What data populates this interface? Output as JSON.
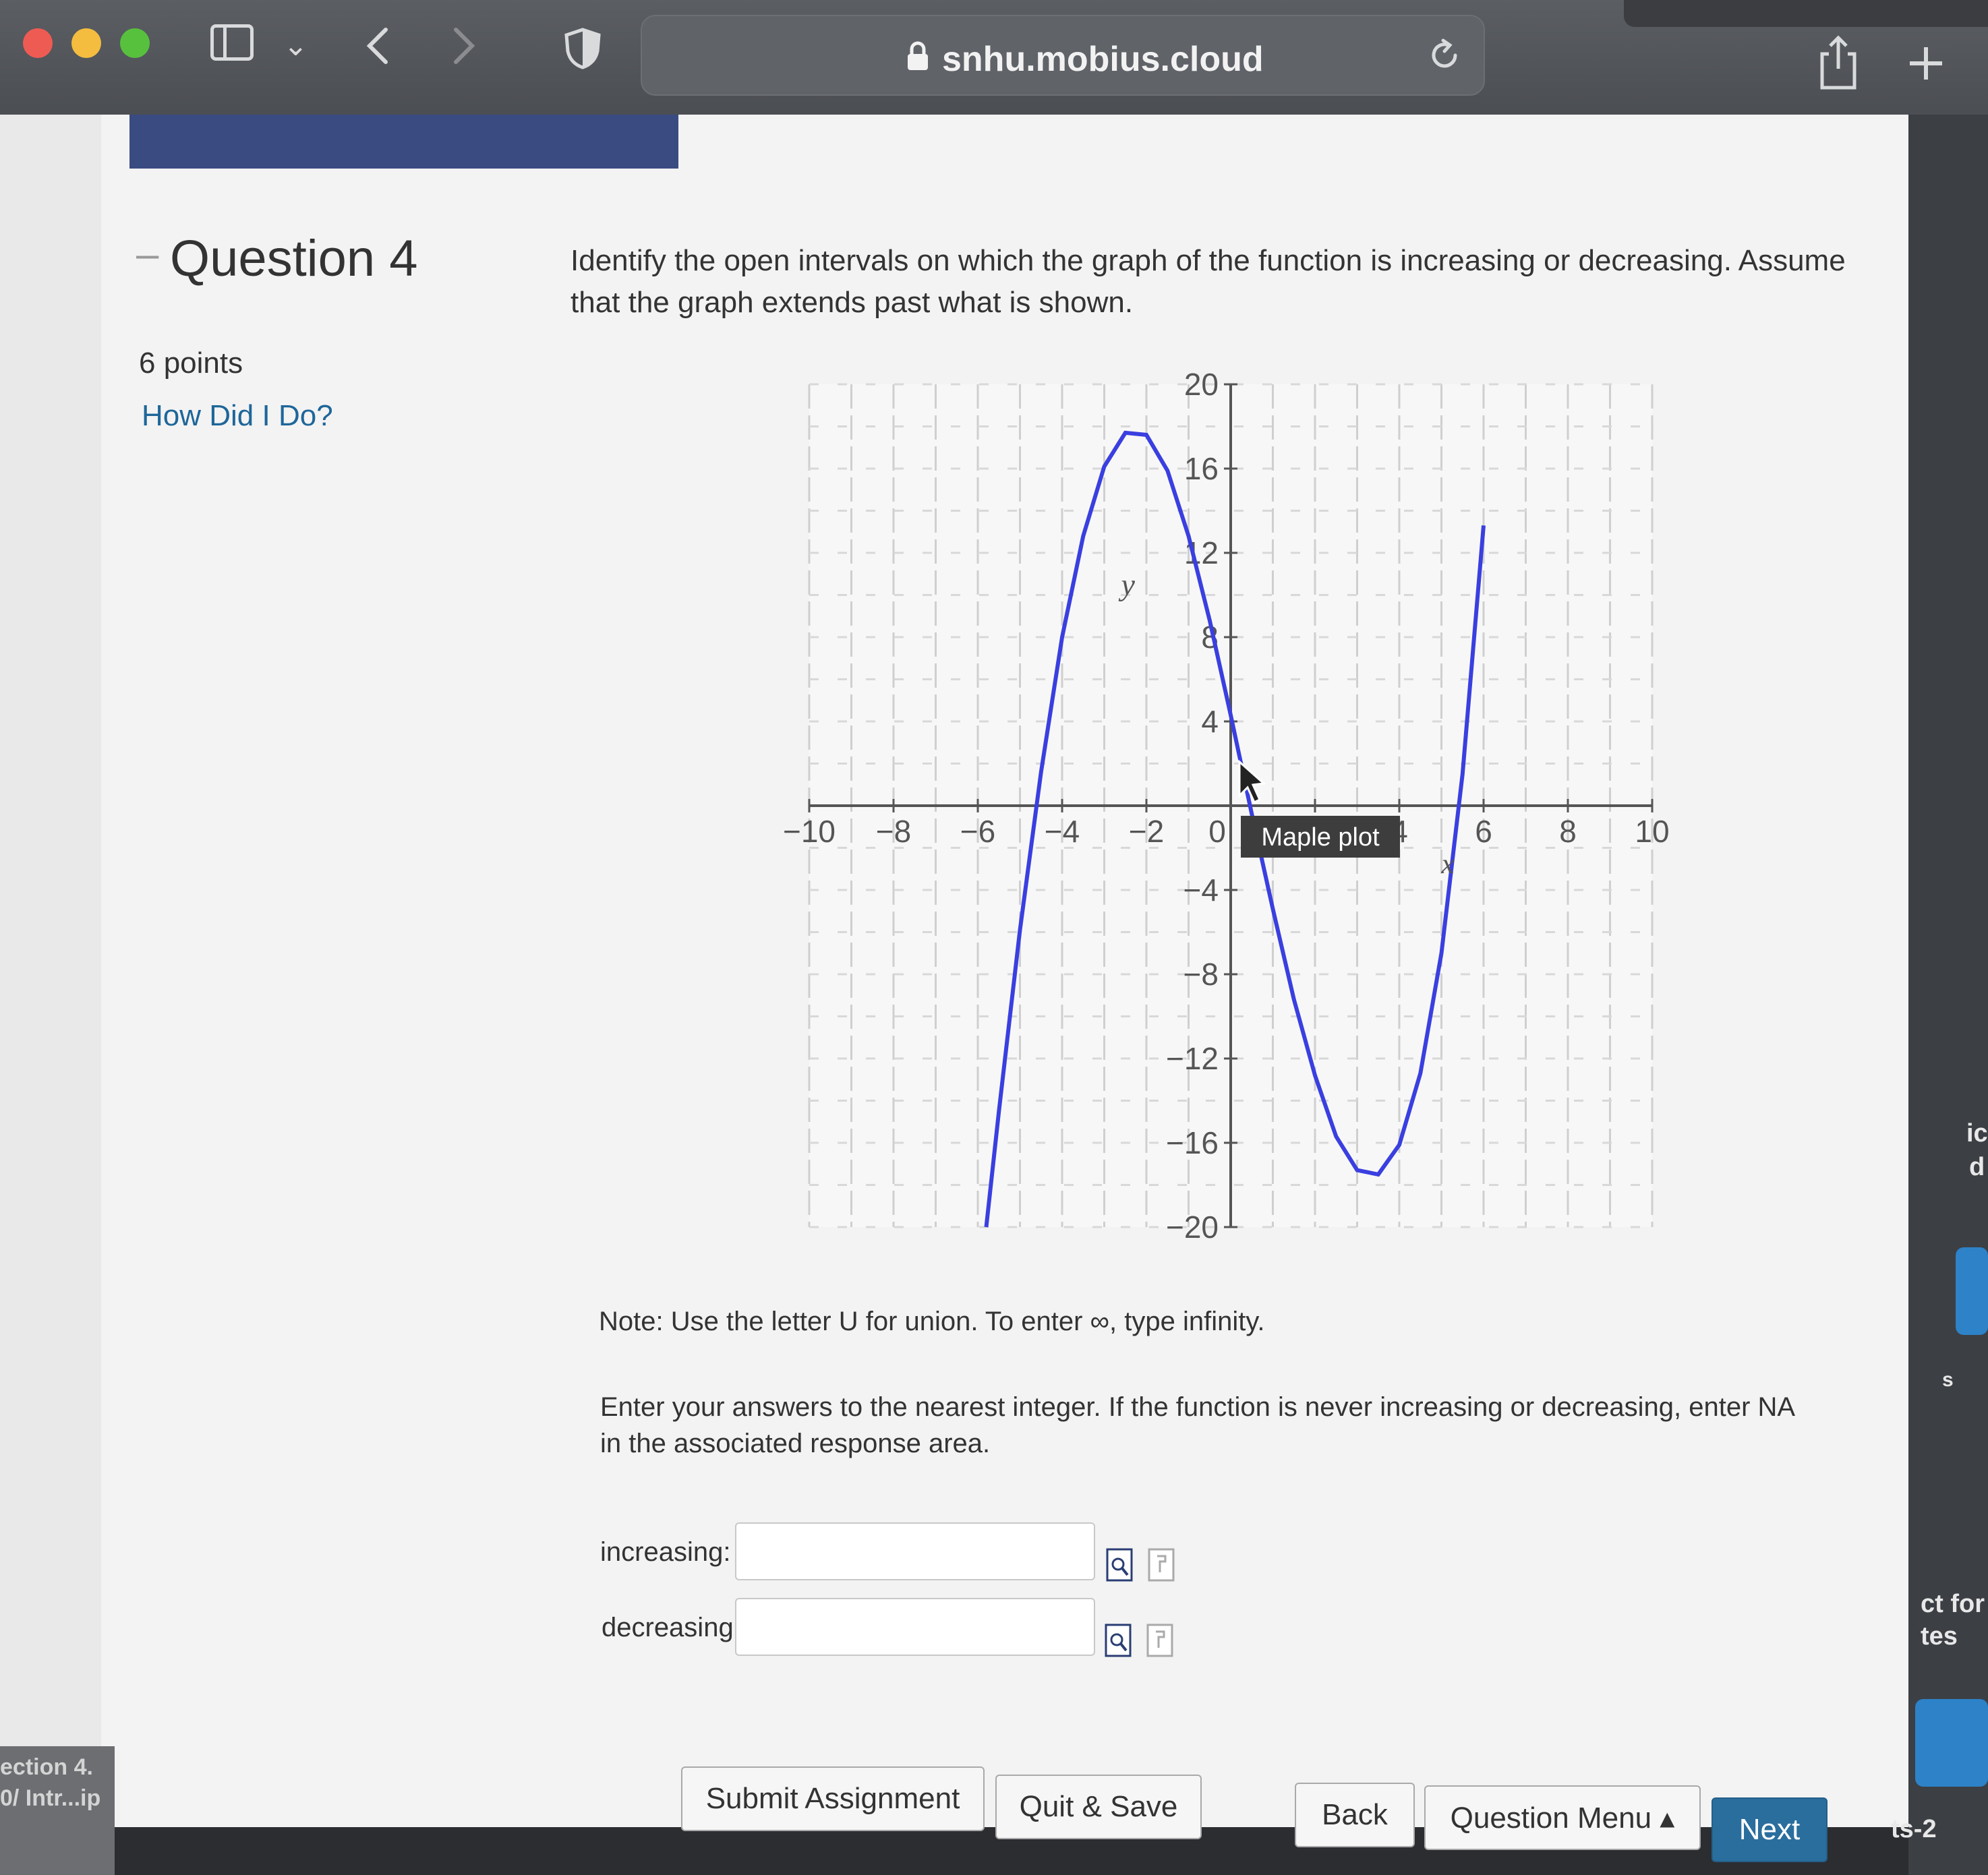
{
  "browser": {
    "url": "snhu.mobius.cloud"
  },
  "question": {
    "title": "Question 4",
    "points": "6 points",
    "how_link": "How Did I Do?",
    "prompt": "Identify the open intervals on which the graph of the function is increasing or decreasing. Assume that the graph extends past what is shown.",
    "note": "Note: Use the letter U for union. To enter ∞, type infinity.",
    "instructions": "Enter your answers to the nearest integer. If the function is never increasing or decreasing, enter NA in the associated response area.",
    "increasing_label": "increasing:",
    "increasing_value": "",
    "decreasing_label": "decreasing:",
    "decreasing_value": ""
  },
  "plot": {
    "tooltip": "Maple plot"
  },
  "chart_data": {
    "type": "line",
    "xlabel": "x",
    "ylabel": "y",
    "xlim": [
      -10,
      10
    ],
    "ylim": [
      -20,
      20
    ],
    "x_ticks": [
      -10,
      -8,
      -6,
      -4,
      -2,
      0,
      2,
      4,
      6,
      8,
      10
    ],
    "y_ticks": [
      -20,
      -16,
      -12,
      -8,
      -4,
      4,
      8,
      12,
      16,
      20
    ],
    "series": [
      {
        "color": "#3a3fe0",
        "x": [
          -5.8,
          -5.5,
          -5,
          -4.5,
          -4,
          -3.5,
          -3,
          -2.5,
          -2,
          -1.5,
          -1,
          -0.5,
          0,
          0.5,
          1,
          1.5,
          2,
          2.5,
          3,
          3.5,
          4,
          4.5,
          5,
          5.5,
          6
        ],
        "y": [
          -20,
          -14.5,
          -5.9,
          1.6,
          8,
          12.8,
          16.1,
          17.7,
          17.6,
          15.9,
          12.8,
          8.8,
          4.3,
          -0.4,
          -4.9,
          -9.2,
          -12.8,
          -15.7,
          -17.3,
          -17.5,
          -16.1,
          -12.7,
          -7.0,
          1.5,
          13.3
        ]
      }
    ]
  },
  "footer": {
    "submit": "Submit Assignment",
    "quit": "Quit & Save",
    "back": "Back",
    "menu": "Question Menu ▴",
    "next": "Next"
  },
  "background_window": {
    "side_1": "ic",
    "side_2": "d",
    "side_3": "s",
    "side_4": "ct for",
    "side_5": "tes",
    "side_6": "ts-2",
    "bottom_1": "ection 4.",
    "bottom_2": "0/ Intr...ip"
  }
}
